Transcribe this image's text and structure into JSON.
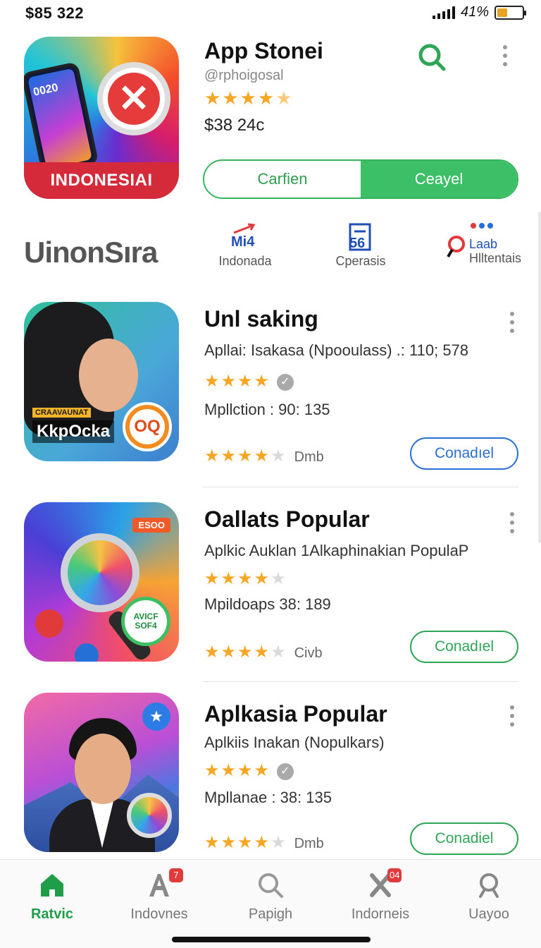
{
  "status_bar": {
    "time": "$85 322",
    "battery_percent": "41%",
    "battery_level": 0.41
  },
  "hero": {
    "title": "App Stonei",
    "developer": "@rphoigosal",
    "rating": 4.5,
    "rating_text": "★★★★½",
    "price": "$38 24c",
    "icon_banner": "INDONESIAI",
    "icon_phone_text": "0020",
    "icon_x_glyph": "✕",
    "buttons": {
      "left": "Carfien",
      "right": "Ceayel"
    }
  },
  "categories": {
    "brand": "UinonSıra",
    "items": [
      {
        "icon_text": "Mi4",
        "label": "Indonada"
      },
      {
        "icon_text": "56",
        "label": "Cperasis"
      },
      {
        "icon_text": "Laab",
        "label": "Hlltentais"
      }
    ]
  },
  "apps": [
    {
      "name": "Unl saking",
      "subtitle": "Apllai: Isakasa (Npooulass) .: 110; 578",
      "stars_top": "★★★★",
      "meta": "Mpllction : 90: 135",
      "stars_bottom": "★★★★",
      "stars_bottom_dim": "★",
      "tag": "Dmb",
      "button": "Conadıel",
      "button_color": "#2a6fd6",
      "icon_badge_top": "CRAAVAUNAT",
      "icon_badge_text": "KkpOcka",
      "icon_circle_text": "OQ"
    },
    {
      "name": "Oallats Popular",
      "subtitle": "Aplkic Auklan 1Alkaphinakian PopulaP",
      "stars_top": "★★★★",
      "stars_top_dim": "★",
      "meta": "Mpildoaps 38: 189",
      "stars_bottom": "★★★★",
      "stars_bottom_dim": "★",
      "tag": "Civb",
      "button": "Conadıel",
      "button_color": "#2fa657",
      "icon_tag": "ESOO",
      "icon_green_line1": "AVICF",
      "icon_green_line2": "SOF4"
    },
    {
      "name": "Aplkasia Popular",
      "subtitle": "Aplkiis Inakan (Nopulkars)",
      "stars_top": "★★★★",
      "meta": "Mpllanae : 38: 135",
      "stars_bottom": "★★★★",
      "stars_bottom_dim": "★",
      "tag": "Dmb",
      "button": "Conadiel",
      "button_color": "#2fa657",
      "icon_star": "★"
    }
  ],
  "bottom_nav": [
    {
      "label": "Ratvic",
      "icon": "home-icon",
      "active": true
    },
    {
      "label": "Indovnes",
      "icon": "apps-icon",
      "badge": "7"
    },
    {
      "label": "Papigh",
      "icon": "search-icon"
    },
    {
      "label": "Indorneis",
      "icon": "games-icon",
      "badge": "04"
    },
    {
      "label": "Uayoo",
      "icon": "profile-search-icon"
    }
  ],
  "colors": {
    "accent_green": "#3dbf67",
    "star": "#f5a623",
    "active_nav": "#1f9d48"
  }
}
